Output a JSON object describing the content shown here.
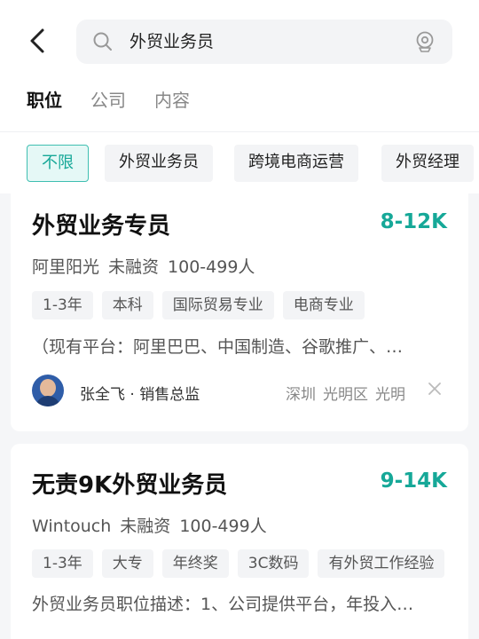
{
  "header": {
    "search_text": "外贸业务员"
  },
  "tabs": [
    {
      "label": "职位",
      "active": true
    },
    {
      "label": "公司",
      "active": false
    },
    {
      "label": "内容",
      "active": false
    }
  ],
  "filters": [
    {
      "label": "不限",
      "active": true
    },
    {
      "label": "外贸业务员",
      "active": false
    },
    {
      "label": "跨境电商运营",
      "active": false
    },
    {
      "label": "外贸经理",
      "active": false
    }
  ],
  "jobs": [
    {
      "title": "外贸业务专员",
      "salary": "8-12K",
      "company": "阿里阳光",
      "funding": "未融资",
      "size": "100-499人",
      "tags": [
        "1-3年",
        "本科",
        "国际贸易专业",
        "电商专业"
      ],
      "description": "（现有平台：阿里巴巴、中国制造、谷歌推广、…",
      "recruiter": "张全飞 · 销售总监",
      "location": [
        "深圳",
        "光明区",
        "光明"
      ]
    },
    {
      "title": "无责9K外贸业务员",
      "salary": "9-14K",
      "company": "Wintouch",
      "funding": "未融资",
      "size": "100-499人",
      "tags": [
        "1-3年",
        "大专",
        "年终奖",
        "3C数码",
        "有外贸工作经验"
      ],
      "description": "外贸业务员职位描述：1、公司提供平台，年投入…"
    }
  ],
  "colors": {
    "accent": "#16a898",
    "chip_active_bg": "#e5f8f6"
  },
  "icons": [
    "back-arrow-icon",
    "search-icon",
    "location-icon",
    "close-icon"
  ]
}
